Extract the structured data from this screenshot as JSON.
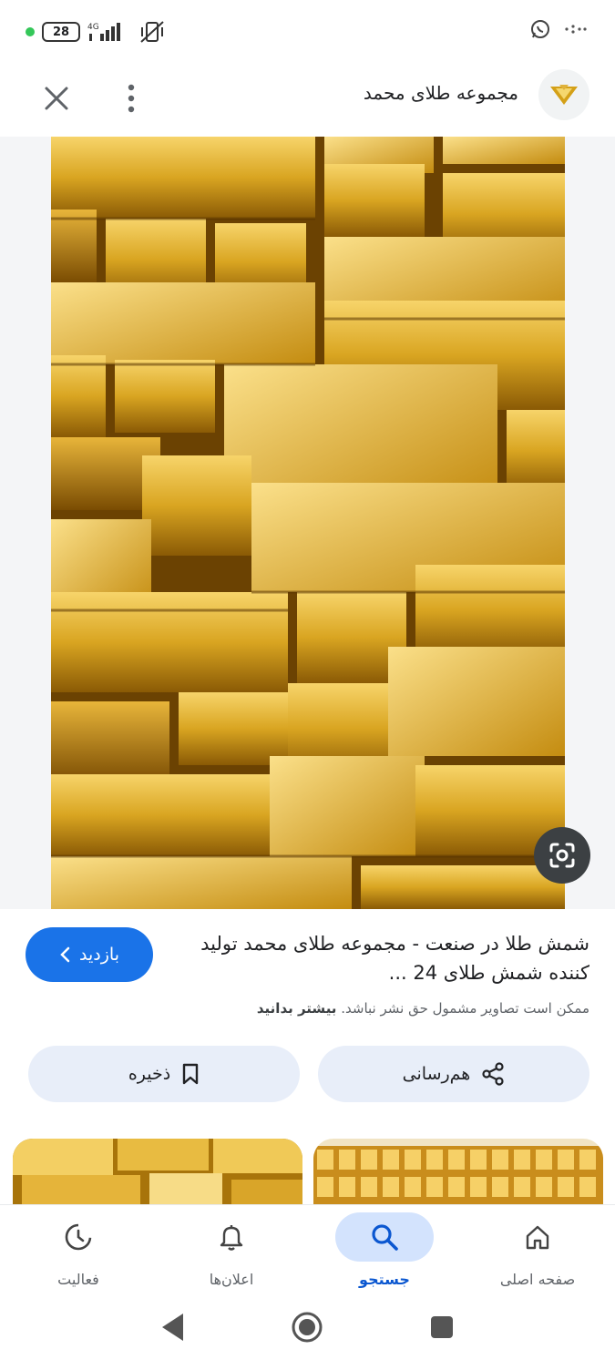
{
  "status_bar": {
    "battery": "28",
    "network": "4G"
  },
  "header": {
    "site_name": "مجموعه طلای محمد"
  },
  "result": {
    "title": "شمش طلا در صنعت - مجموعه طلای محمد تولید کننده شمش طلای 24 ...",
    "copyright_notice": "ممکن است تصاویر مشمول حق نشر نباشد.",
    "learn_more": "بیشتر بدانید",
    "visit_label": "بازدید",
    "share_label": "هم‌رسانی",
    "save_label": "ذخیره"
  },
  "bottom_nav": {
    "items": [
      {
        "label": "صفحه اصلی",
        "icon": "home-icon"
      },
      {
        "label": "جستجو",
        "icon": "search-icon",
        "active": true
      },
      {
        "label": "اعلان‌ها",
        "icon": "bell-icon"
      },
      {
        "label": "فعالیت",
        "icon": "activity-icon"
      }
    ]
  },
  "colors": {
    "accent": "#1a73e8",
    "active_nav": "#0b57d0",
    "pill_bg": "#e8eef9",
    "gold": "#d4a017"
  }
}
